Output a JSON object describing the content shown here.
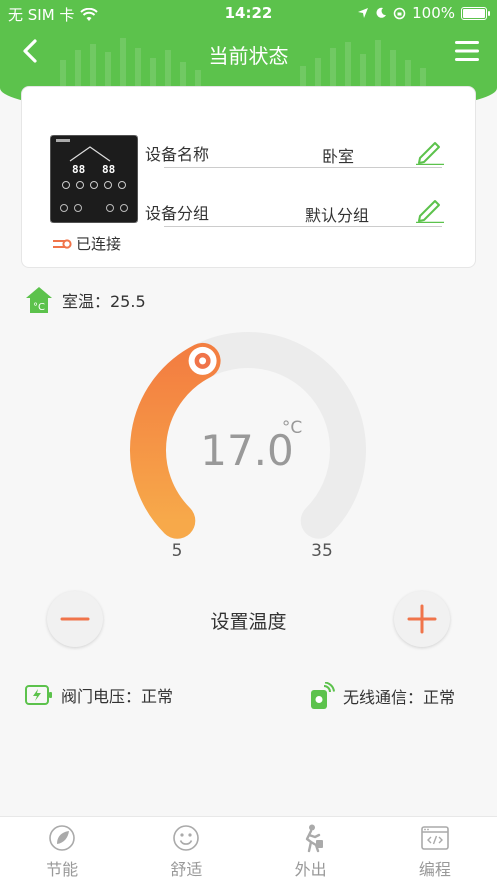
{
  "status_bar": {
    "carrier": "无 SIM 卡",
    "time": "14:22",
    "battery": "100%"
  },
  "nav": {
    "title": "当前状态"
  },
  "device": {
    "name_label": "设备名称",
    "name_value": "卧室",
    "group_label": "设备分组",
    "group_value": "默认分组",
    "status": "已连接"
  },
  "room": {
    "label": "室温：25.5"
  },
  "gauge": {
    "value": "17.0",
    "unit": "°C",
    "min_label": "5",
    "max_label": "35",
    "min": 5,
    "max": 35,
    "current": 17
  },
  "set_label": "设置温度",
  "status": {
    "valve": "阀门电压：正常",
    "wireless": "无线通信：正常"
  },
  "tabs": [
    {
      "label": "节能",
      "icon": "leaf-icon"
    },
    {
      "label": "舒适",
      "icon": "smiley-icon"
    },
    {
      "label": "外出",
      "icon": "walking-icon"
    },
    {
      "label": "编程",
      "icon": "code-icon"
    }
  ],
  "colors": {
    "green": "#5cc24c",
    "orange": "#f5903f",
    "accent": "#f0744a"
  }
}
